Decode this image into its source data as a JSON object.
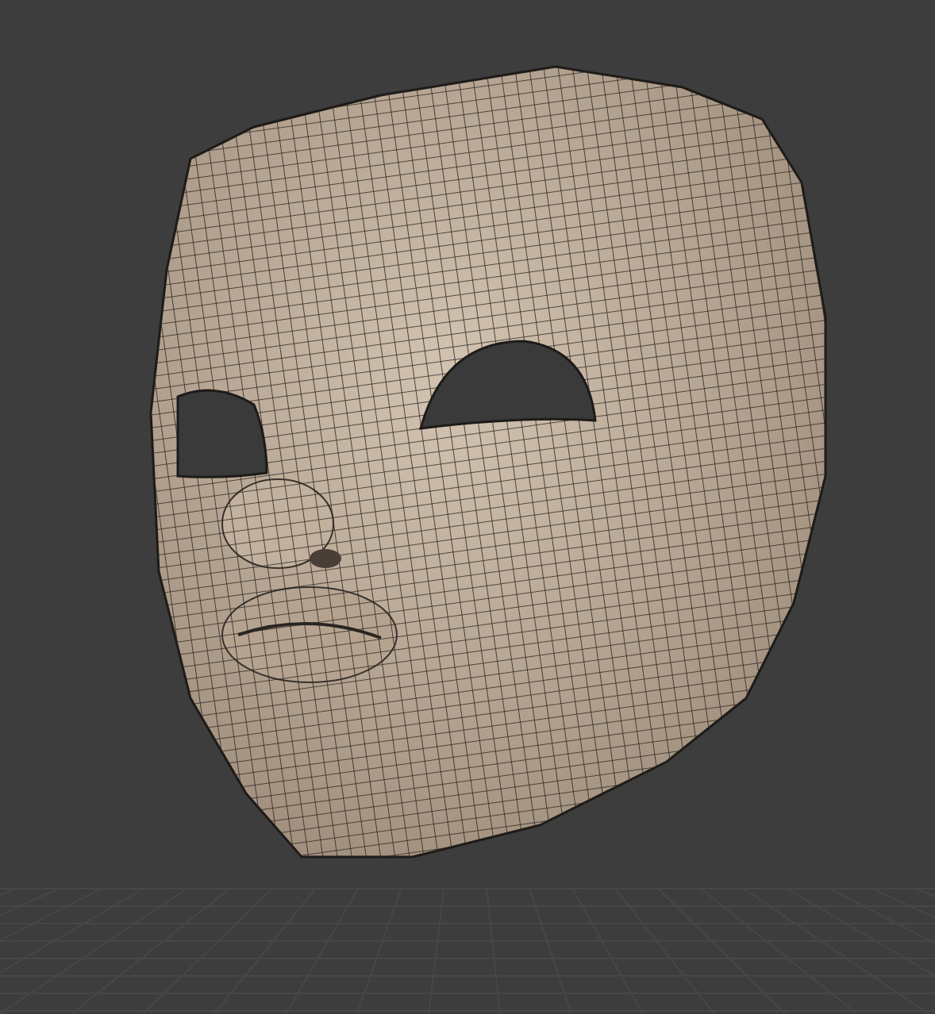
{
  "viewport": {
    "floor_grid": true,
    "wireframe_overlay": true
  }
}
